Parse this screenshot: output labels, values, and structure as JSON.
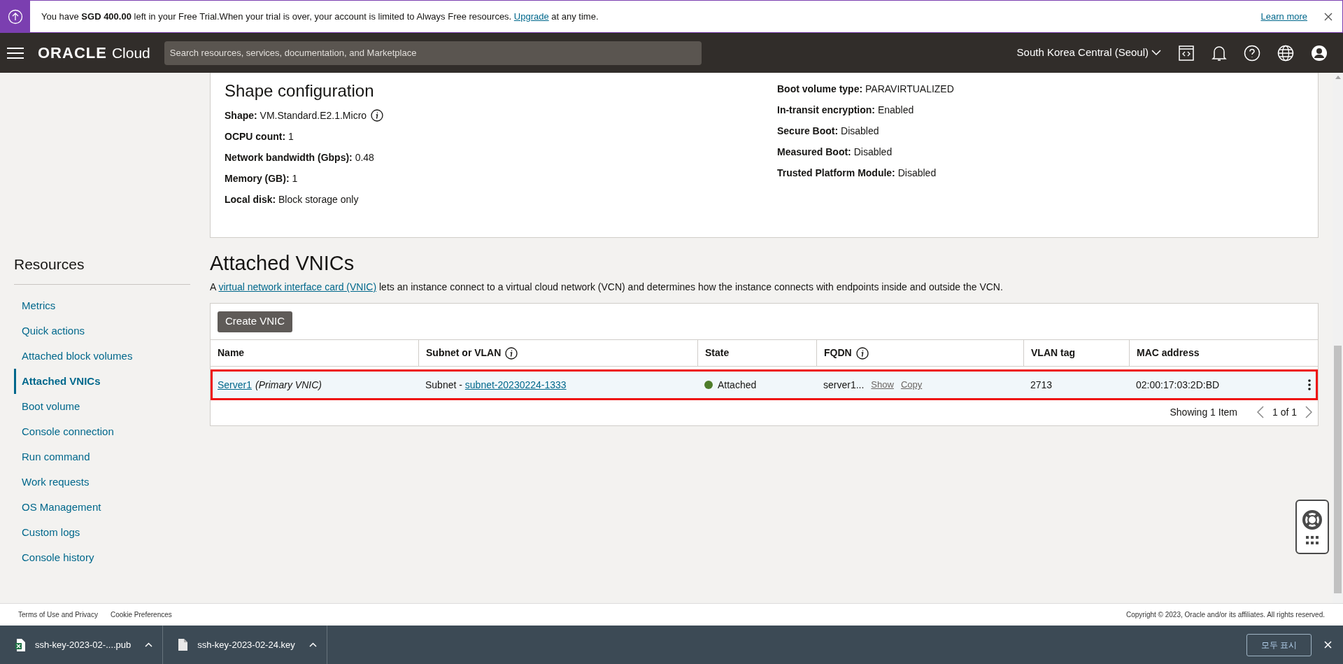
{
  "banner": {
    "text": "You have **SGD 400.00** left in your Free Trial.When your trial is over, your account is limited to Always Free resources. ",
    "link": "Upgrade",
    "text_after": " at any time.",
    "learn_more": "Learn more"
  },
  "header": {
    "logo": "ORACLE",
    "logo_suffix": "Cloud",
    "search": {
      "placeholder": "Search resources, services, documentation, and Marketplace"
    },
    "region": "South Korea Central (Seoul)"
  },
  "shape_configuration": {
    "title": "Shape configuration",
    "left": [
      {
        "label": "Shape:",
        "value": "VM.Standard.E2.1.Micro",
        "info": true
      },
      {
        "label": "OCPU count:",
        "value": "1"
      },
      {
        "label": "Network bandwidth (Gbps):",
        "value": "0.48"
      },
      {
        "label": "Memory (GB):",
        "value": "1"
      },
      {
        "label": "Local disk:",
        "value": "Block storage only"
      }
    ],
    "right": [
      {
        "label": "Boot volume type:",
        "value": "PARAVIRTUALIZED"
      },
      {
        "label": "In-transit encryption:",
        "value": "Enabled"
      },
      {
        "label": "Secure Boot:",
        "value": "Disabled"
      },
      {
        "label": "Measured Boot:",
        "value": "Disabled"
      },
      {
        "label": "Trusted Platform Module:",
        "value": "Disabled"
      }
    ]
  },
  "sidebar": {
    "title": "Resources",
    "items": [
      {
        "label": "Metrics",
        "selected": false
      },
      {
        "label": "Quick actions",
        "selected": false
      },
      {
        "label": "Attached block volumes",
        "selected": false
      },
      {
        "label": "Attached VNICs",
        "selected": true
      },
      {
        "label": "Boot volume",
        "selected": false
      },
      {
        "label": "Console connection",
        "selected": false
      },
      {
        "label": "Run command",
        "selected": false
      },
      {
        "label": "Work requests",
        "selected": false
      },
      {
        "label": "OS Management",
        "selected": false
      },
      {
        "label": "Custom logs",
        "selected": false
      },
      {
        "label": "Console history",
        "selected": false
      }
    ]
  },
  "attached_vnics": {
    "title": "Attached VNICs",
    "description_before": "A ",
    "description_link": "virtual network interface card (VNIC)",
    "description_after": " lets an instance connect to a virtual cloud network (VCN) and determines how the instance connects with endpoints inside and outside the VCN.",
    "create_button": "Create VNIC",
    "columns": [
      {
        "label": "Name",
        "info": false
      },
      {
        "label": "Subnet or VLAN",
        "info": true
      },
      {
        "label": "State",
        "info": false
      },
      {
        "label": "FQDN",
        "info": true
      },
      {
        "label": "VLAN tag",
        "info": false
      },
      {
        "label": "MAC address",
        "info": false
      }
    ],
    "rows": [
      {
        "name": "Server1",
        "name_note": "(Primary VNIC)",
        "subnet_prefix": "Subnet - ",
        "subnet": "subnet-20230224-1333",
        "state": "Attached",
        "color": "#4e7d2a",
        "fqdn": "server1...",
        "fqdn_actions": [
          "Show",
          "Copy"
        ],
        "vlan_tag": "2713",
        "mac_address": "02:00:17:03:2D:BD",
        "highlighted": true
      }
    ],
    "count": "Showing 1 Item",
    "pagination": "1 of 1"
  },
  "footer": {
    "links": [
      "Terms of Use and Privacy",
      "Cookie Preferences"
    ],
    "copyright": "Copyright © 2023, Oracle and/or its affiliates. All rights reserved."
  },
  "downloads": {
    "items": [
      {
        "kind": "spreadsheet",
        "file": "ssh-key-2023-02-....pub"
      },
      {
        "kind": "document",
        "file": "ssh-key-2023-02-24.key"
      }
    ],
    "show_all": "모두 표시"
  }
}
